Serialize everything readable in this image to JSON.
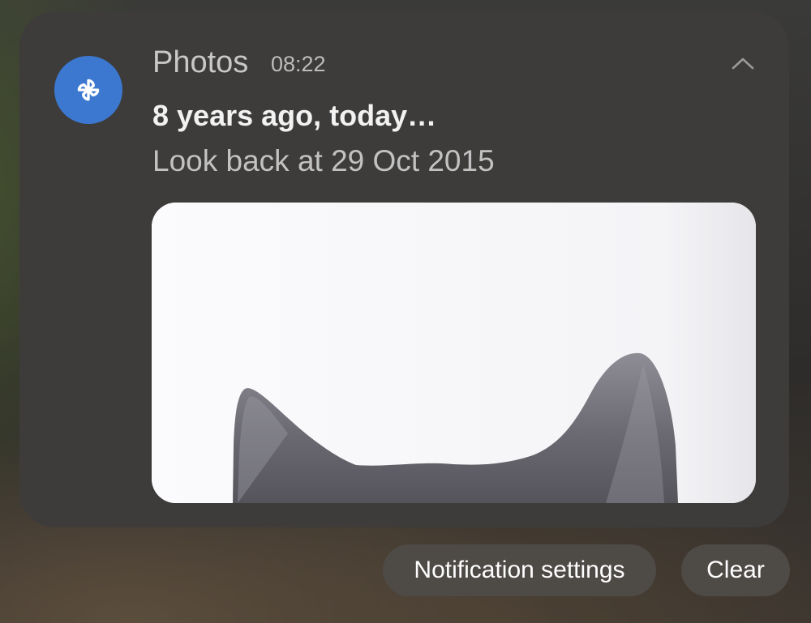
{
  "notification": {
    "app_name": "Photos",
    "time": "08:22",
    "title": "8 years ago, today…",
    "subtitle": "Look back at 29 Oct 2015",
    "app_icon": "pinwheel-icon",
    "collapse_icon": "chevron-up-icon",
    "accent_color": "#3c78d0"
  },
  "actions": {
    "settings_label": "Notification settings",
    "clear_label": "Clear"
  }
}
